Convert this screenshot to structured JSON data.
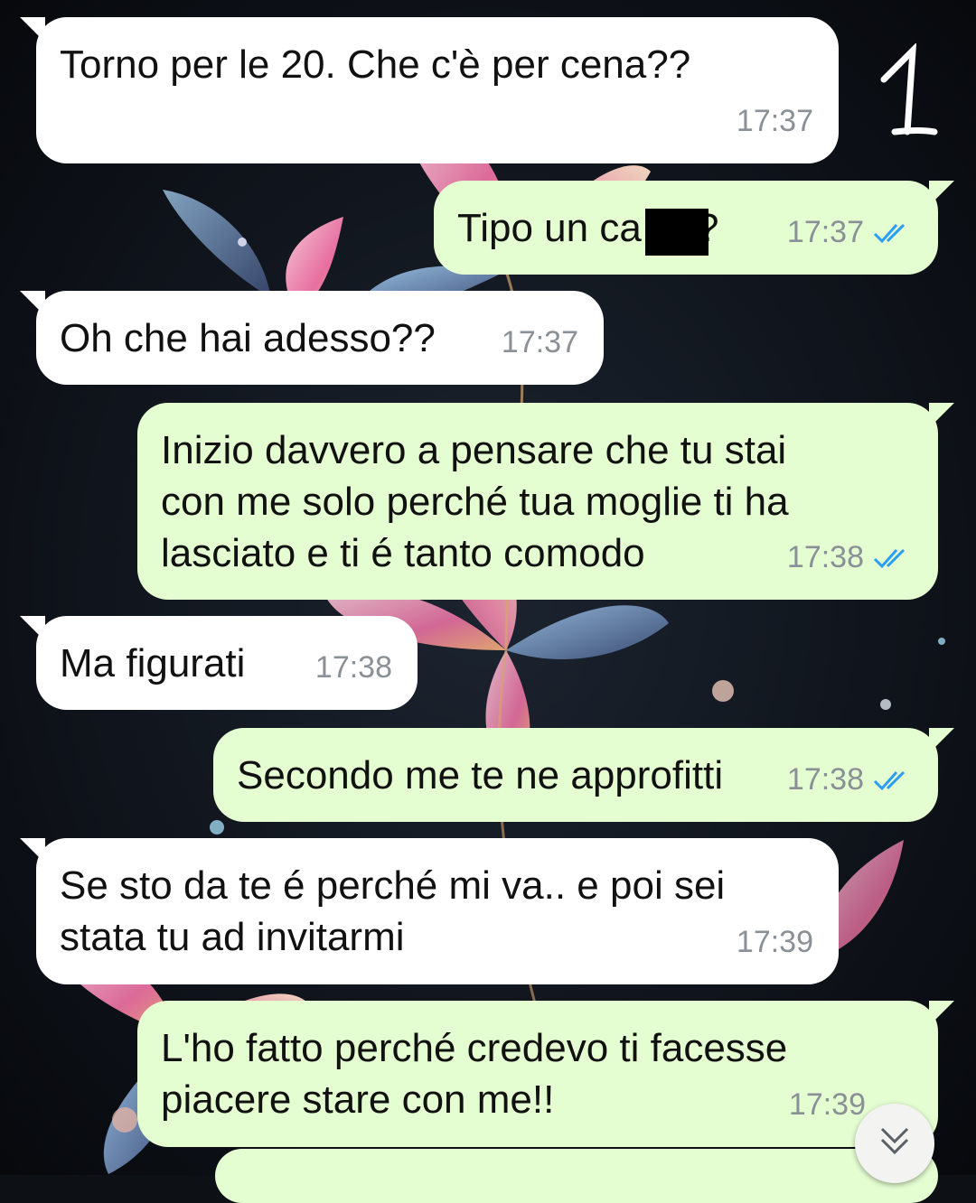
{
  "chat": {
    "messages": [
      {
        "dir": "in",
        "text": "Torno per le 20. Che c'è per cena??",
        "time": "17:37"
      },
      {
        "dir": "out",
        "text": "Tipo un ca    o??",
        "time": "17:37",
        "status": "read"
      },
      {
        "dir": "in",
        "text": "Oh che hai adesso??",
        "time": "17:37"
      },
      {
        "dir": "out",
        "text": "Inizio davvero a pensare che tu stai\ncon me solo perché tua moglie ti ha\nlasciato e ti é tanto comodo",
        "time": "17:38",
        "status": "read"
      },
      {
        "dir": "in",
        "text": "Ma figurati",
        "time": "17:38"
      },
      {
        "dir": "out",
        "text": "Secondo me te ne approfitti",
        "time": "17:38",
        "status": "read"
      },
      {
        "dir": "in",
        "text": "Se sto da te é perché mi va.. e poi sei\nstata tu ad invitarmi",
        "time": "17:39"
      },
      {
        "dir": "out",
        "text": "L'ho fatto perché credevo ti facesse\npiacere stare con me!!",
        "time": "17:39",
        "status": "read"
      }
    ]
  },
  "annotation": {
    "page_number": "1"
  },
  "icons": {
    "read_receipt": "double-check-icon",
    "scroll": "chevron-double-down-icon"
  },
  "colors": {
    "incoming": "#ffffff",
    "outgoing": "#e4fdd1",
    "read_tick": "#2a9df4",
    "meta_text": "#8a9096"
  }
}
